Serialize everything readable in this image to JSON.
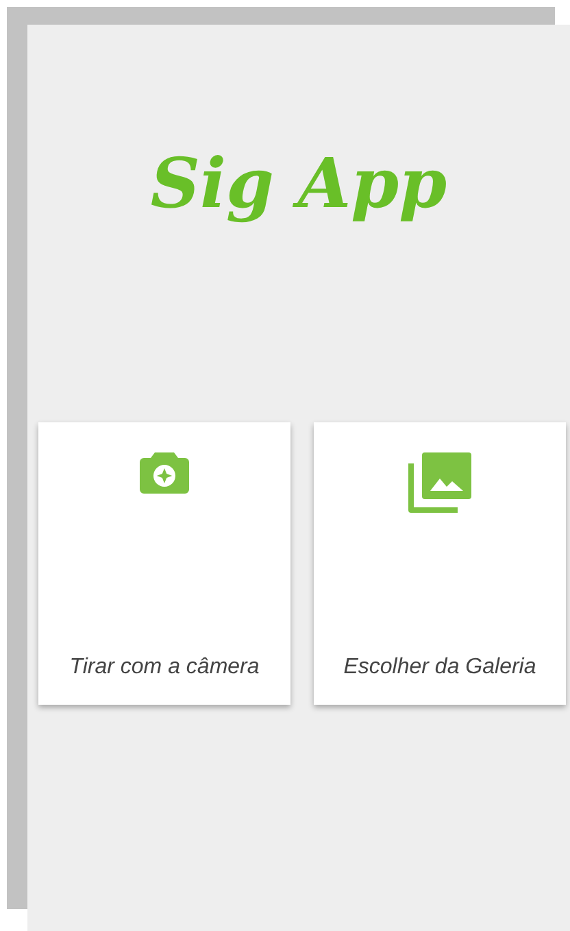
{
  "app_title": "Sig App",
  "options": [
    {
      "kind": "camera",
      "label": "Tirar com a câmera"
    },
    {
      "kind": "gallery",
      "label": "Escolher da Galeria"
    }
  ]
}
